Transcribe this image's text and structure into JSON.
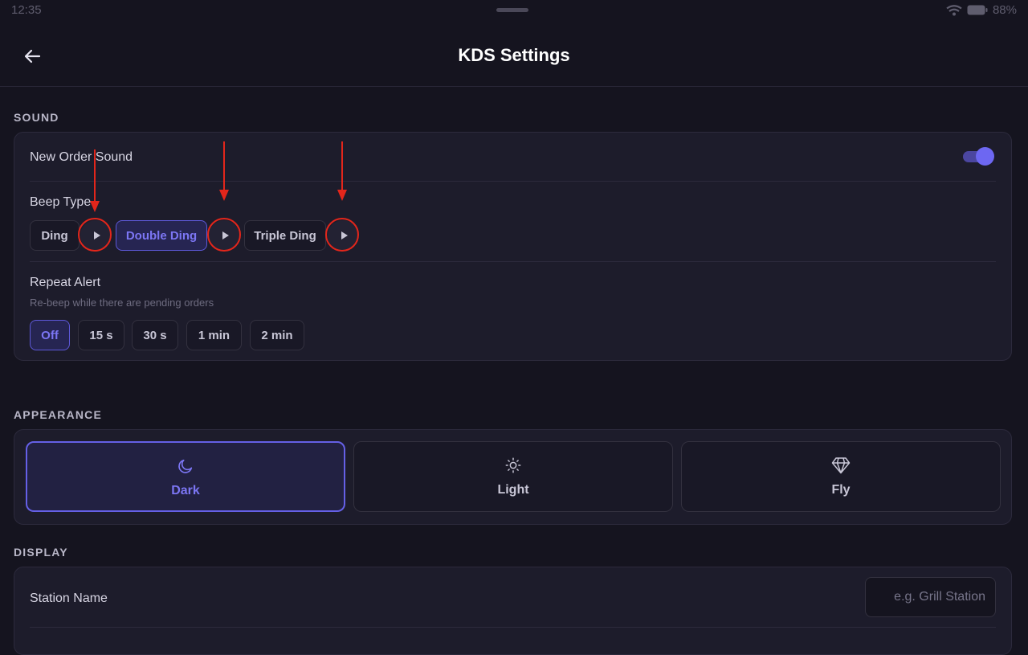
{
  "status_bar": {
    "time": "12:35",
    "battery": "88%"
  },
  "header": {
    "title": "KDS Settings"
  },
  "sound": {
    "section_label": "SOUND",
    "new_order_sound": {
      "label": "New Order Sound",
      "enabled": true
    },
    "beep_type": {
      "label": "Beep Type",
      "options": [
        {
          "label": "Ding",
          "selected": false
        },
        {
          "label": "Double Ding",
          "selected": true
        },
        {
          "label": "Triple Ding",
          "selected": false
        }
      ]
    },
    "repeat_alert": {
      "label": "Repeat Alert",
      "subtitle": "Re-beep while there are pending orders",
      "options": [
        {
          "label": "Off",
          "selected": true
        },
        {
          "label": "15 s",
          "selected": false
        },
        {
          "label": "30 s",
          "selected": false
        },
        {
          "label": "1 min",
          "selected": false
        },
        {
          "label": "2 min",
          "selected": false
        }
      ]
    }
  },
  "appearance": {
    "section_label": "APPEARANCE",
    "themes": [
      {
        "label": "Dark",
        "icon": "moon-icon",
        "selected": true
      },
      {
        "label": "Light",
        "icon": "sun-icon",
        "selected": false
      },
      {
        "label": "Fly",
        "icon": "diamond-icon",
        "selected": false
      }
    ]
  },
  "display": {
    "section_label": "DISPLAY",
    "station_name": {
      "label": "Station Name",
      "value": "",
      "placeholder": "e.g. Grill Station"
    }
  },
  "colors": {
    "accent": "#6d67f2",
    "annotation": "#e3261b",
    "background": "#15141f",
    "card": "#1d1c2b"
  }
}
